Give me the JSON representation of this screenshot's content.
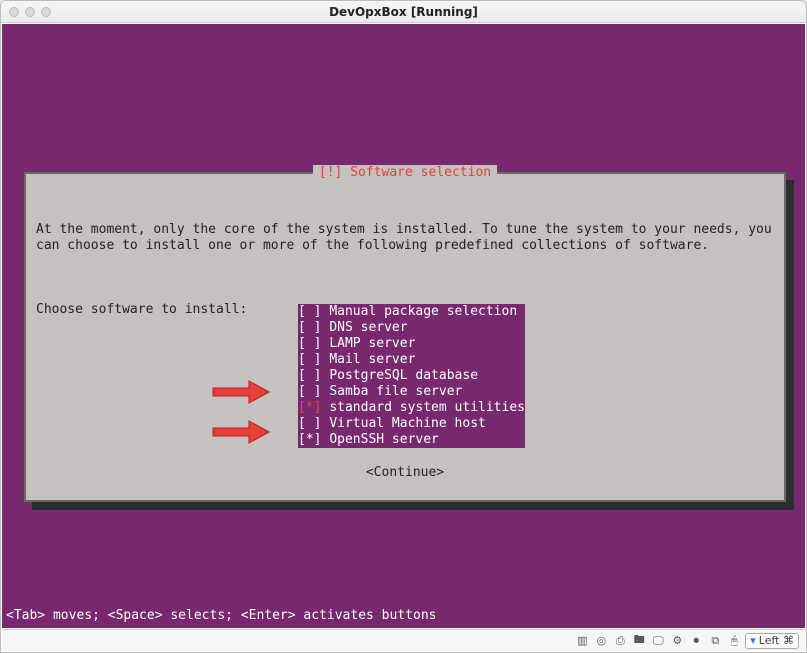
{
  "window": {
    "title": "DevOpxBox [Running]"
  },
  "dialog": {
    "title": "[!] Software selection",
    "para": "At the moment, only the core of the system is installed. To tune the system to your needs, you can choose to install one or more of the following predefined collections of software.",
    "prompt": "Choose software to install:",
    "continue": "<Continue>"
  },
  "menu": [
    {
      "checked": false,
      "highlighted": false,
      "label": "Manual package selection"
    },
    {
      "checked": false,
      "highlighted": false,
      "label": "DNS server"
    },
    {
      "checked": false,
      "highlighted": false,
      "label": "LAMP server"
    },
    {
      "checked": false,
      "highlighted": false,
      "label": "Mail server"
    },
    {
      "checked": false,
      "highlighted": false,
      "label": "PostgreSQL database"
    },
    {
      "checked": false,
      "highlighted": false,
      "label": "Samba file server"
    },
    {
      "checked": true,
      "highlighted": true,
      "label": "standard system utilities"
    },
    {
      "checked": false,
      "highlighted": false,
      "label": "Virtual Machine host"
    },
    {
      "checked": true,
      "highlighted": false,
      "label": "OpenSSH server"
    }
  ],
  "hint": "<Tab> moves; <Space> selects; <Enter> activates buttons",
  "host_status": {
    "key_label": "Left ⌘"
  }
}
